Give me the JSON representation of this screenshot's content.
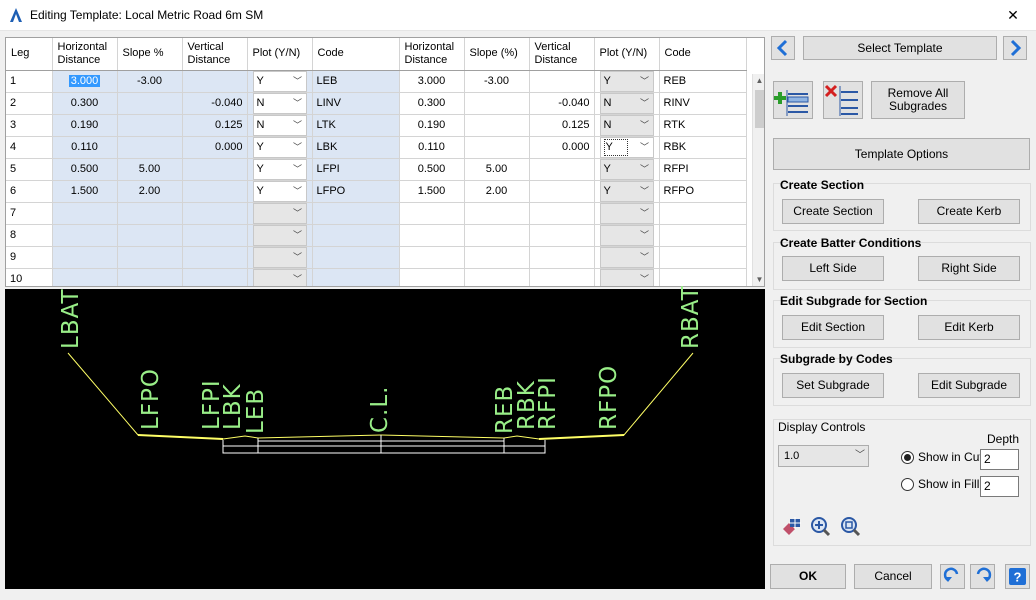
{
  "window": {
    "title": "Editing Template: Local Metric Road 6m SM",
    "close_label": "✕"
  },
  "grid": {
    "headers": [
      "Leg",
      "Horizontal Distance",
      "Slope %",
      "Vertical Distance",
      "Plot (Y/N)",
      "Code",
      "Horizontal Distance",
      "Slope (%)",
      "Vertical Distance",
      "Plot (Y/N)",
      "Code"
    ],
    "rows": [
      {
        "leg": "1",
        "lhd": "3.000",
        "lsl": "-3.00",
        "lvd": "",
        "lplot": "Y",
        "lcode": "LEB",
        "rhd": "3.000",
        "rsl": "-3.00",
        "rvd": "",
        "rplot": "Y",
        "rcode": "REB"
      },
      {
        "leg": "2",
        "lhd": "0.300",
        "lsl": "",
        "lvd": "-0.040",
        "lplot": "N",
        "lcode": "LINV",
        "rhd": "0.300",
        "rsl": "",
        "rvd": "-0.040",
        "rplot": "N",
        "rcode": "RINV"
      },
      {
        "leg": "3",
        "lhd": "0.190",
        "lsl": "",
        "lvd": "0.125",
        "lplot": "N",
        "lcode": "LTK",
        "rhd": "0.190",
        "rsl": "",
        "rvd": "0.125",
        "rplot": "N",
        "rcode": "RTK"
      },
      {
        "leg": "4",
        "lhd": "0.110",
        "lsl": "",
        "lvd": "0.000",
        "lplot": "Y",
        "lcode": "LBK",
        "rhd": "0.110",
        "rsl": "",
        "rvd": "0.000",
        "rplot": "Y",
        "rcode": "RBK"
      },
      {
        "leg": "5",
        "lhd": "0.500",
        "lsl": "5.00",
        "lvd": "",
        "lplot": "Y",
        "lcode": "LFPI",
        "rhd": "0.500",
        "rsl": "5.00",
        "rvd": "",
        "rplot": "Y",
        "rcode": "RFPI"
      },
      {
        "leg": "6",
        "lhd": "1.500",
        "lsl": "2.00",
        "lvd": "",
        "lplot": "Y",
        "lcode": "LFPO",
        "rhd": "1.500",
        "rsl": "2.00",
        "rvd": "",
        "rplot": "Y",
        "rcode": "RFPO"
      },
      {
        "leg": "7",
        "lhd": "",
        "lsl": "",
        "lvd": "",
        "lplot": "",
        "lcode": "",
        "rhd": "",
        "rsl": "",
        "rvd": "",
        "rplot": "",
        "rcode": ""
      },
      {
        "leg": "8",
        "lhd": "",
        "lsl": "",
        "lvd": "",
        "lplot": "",
        "lcode": "",
        "rhd": "",
        "rsl": "",
        "rvd": "",
        "rplot": "",
        "rcode": ""
      },
      {
        "leg": "9",
        "lhd": "",
        "lsl": "",
        "lvd": "",
        "lplot": "",
        "lcode": "",
        "rhd": "",
        "rsl": "",
        "rvd": "",
        "rplot": "",
        "rcode": ""
      },
      {
        "leg": "10",
        "lhd": "",
        "lsl": "",
        "lvd": "",
        "lplot": "",
        "lcode": "",
        "rhd": "",
        "rsl": "",
        "rvd": "",
        "rplot": "",
        "rcode": ""
      }
    ]
  },
  "preview": {
    "labels": [
      "LBAT",
      "LFPO",
      "LFPI",
      "LBK",
      "LEB",
      "C.L.",
      "REB",
      "RBK",
      "RFPI",
      "RFPO",
      "RBAT"
    ],
    "label_color": "#99ee88"
  },
  "panel": {
    "select_template": "Select Template",
    "remove_all": "Remove All Subgrades",
    "template_options": "Template Options",
    "create_section": {
      "title": "Create Section",
      "btn1": "Create Section",
      "btn2": "Create Kerb"
    },
    "batter": {
      "title": "Create Batter Conditions",
      "btn1": "Left Side",
      "btn2": "Right Side"
    },
    "edit_subgrade": {
      "title": "Edit Subgrade for Section",
      "btn1": "Edit Section",
      "btn2": "Edit Kerb"
    },
    "subgrade_codes": {
      "title": "Subgrade by Codes",
      "btn1": "Set Subgrade",
      "btn2": "Edit Subgrade"
    },
    "display": {
      "title": "Display Controls",
      "scale": "1.0",
      "depth_label": "Depth",
      "show_cut": "Show in Cut",
      "cut_value": "2",
      "show_fill": "Show in Fill",
      "fill_value": "2"
    },
    "ok": "OK",
    "cancel": "Cancel"
  }
}
